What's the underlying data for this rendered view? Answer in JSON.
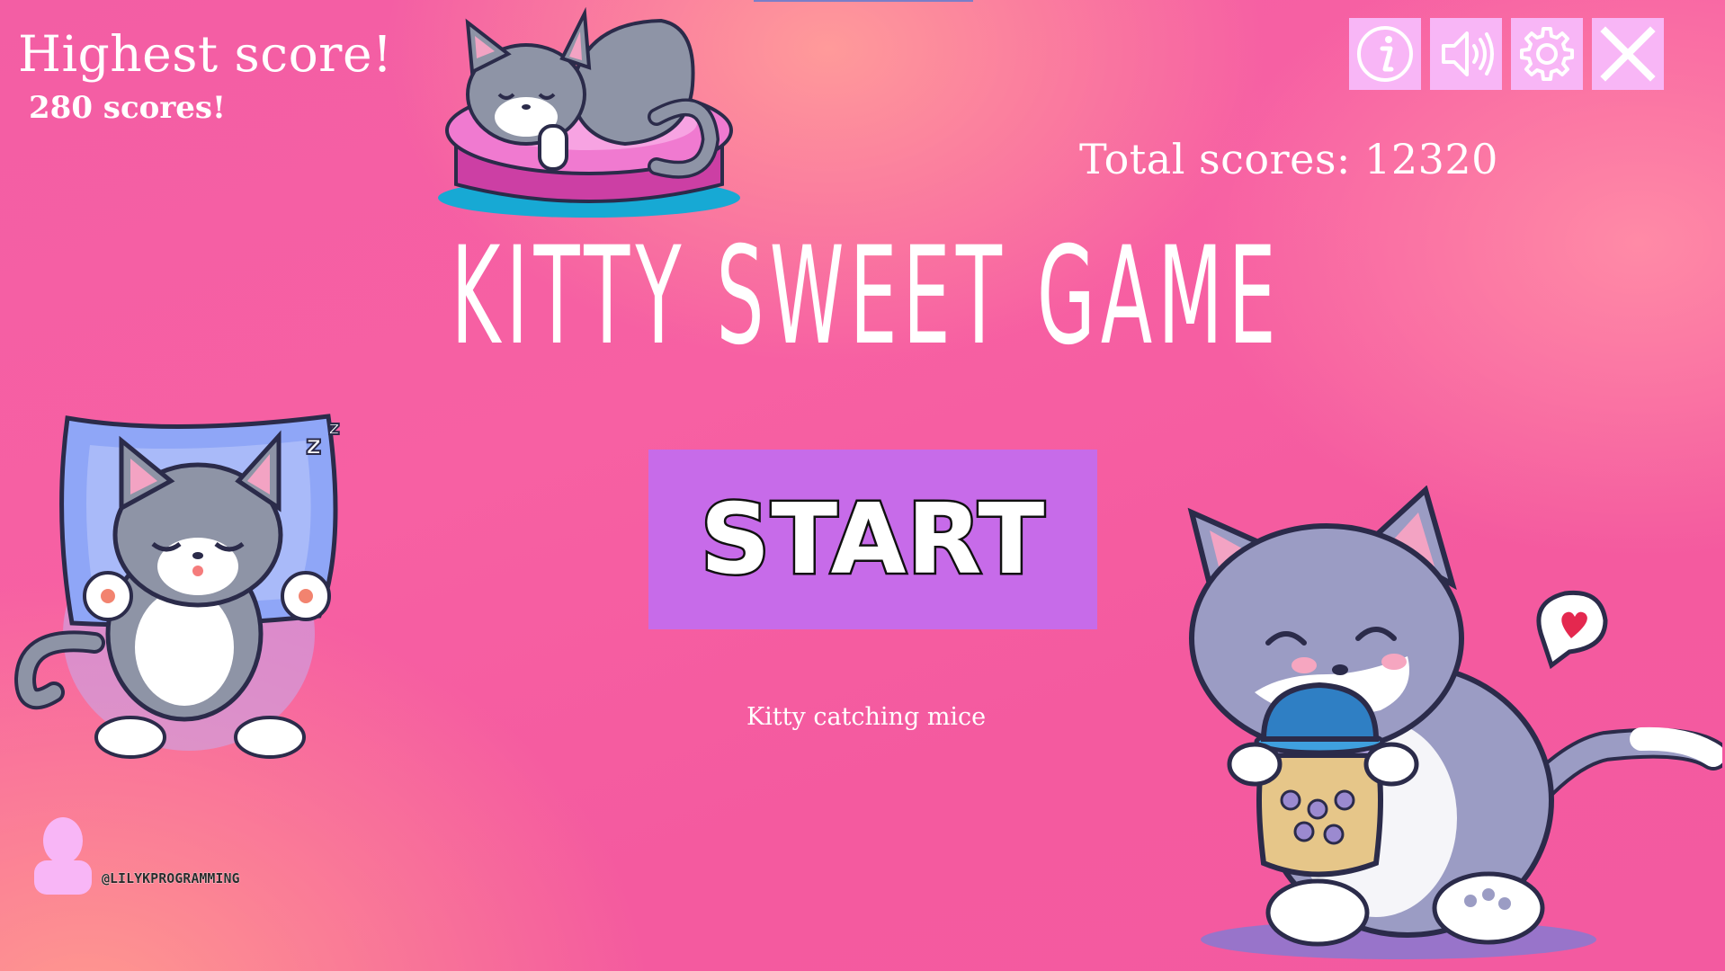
{
  "highest": {
    "title": "Highest score!",
    "value": "280 scores!"
  },
  "total": {
    "label": "Total scores: 12320"
  },
  "toolbar": {
    "info_icon": "info-icon",
    "sound_icon": "speaker-icon",
    "settings_icon": "gear-icon",
    "close_icon": "close-icon"
  },
  "game": {
    "title": "KITTY SWEET GAME",
    "start_label": "START",
    "subtitle": "Kitty catching mice"
  },
  "author": {
    "handle": "@LILYKPROGRAMMING"
  },
  "colors": {
    "background": "#f45ea3",
    "start_button": "#c76be9",
    "icon_button": "#f8b6f6"
  }
}
